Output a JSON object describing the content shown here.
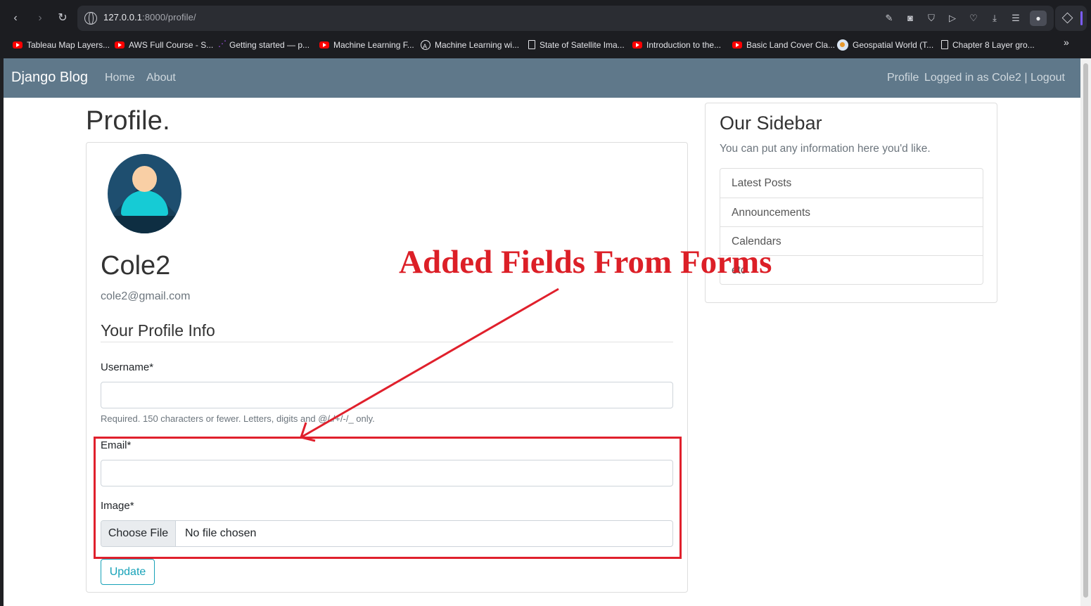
{
  "browser": {
    "url_host": "127.0.0.1",
    "url_rest": ":8000/profile/",
    "bookmarks": [
      {
        "label": "Tableau Map Layers...",
        "icon": "youtube-icon"
      },
      {
        "label": "AWS Full Course - S...",
        "icon": "youtube-icon"
      },
      {
        "label": "Getting started — p...",
        "icon": "app-icon"
      },
      {
        "label": "Machine Learning F...",
        "icon": "youtube-icon"
      },
      {
        "label": "Machine Learning wi...",
        "icon": "site-icon"
      },
      {
        "label": "State of Satellite Ima...",
        "icon": "document-icon"
      },
      {
        "label": "Introduction to the...",
        "icon": "youtube-icon"
      },
      {
        "label": "Basic Land Cover Cla...",
        "icon": "youtube-icon"
      },
      {
        "label": "Geospatial World (T...",
        "icon": "globe-icon"
      },
      {
        "label": "Chapter 8 Layer gro...",
        "icon": "document-icon"
      }
    ],
    "more_label": "»"
  },
  "navbar": {
    "brand": "Django Blog",
    "links": [
      "Home",
      "About"
    ],
    "right": {
      "profile": "Profile",
      "logged_in": "Logged in as Cole2 |",
      "logout": "Logout"
    }
  },
  "main": {
    "title": "Profile.",
    "username": "Cole2",
    "email": "cole2@gmail.com",
    "section_title": "Your Profile Info",
    "form": {
      "username_label": "Username*",
      "username_value": "",
      "username_help": "Required. 150 characters or fewer. Letters, digits and @/./+/-/_ only.",
      "email_label": "Email*",
      "email_value": "",
      "image_label": "Image*",
      "file_button": "Choose File",
      "file_status": "No file chosen",
      "submit": "Update"
    }
  },
  "sidebar": {
    "title": "Our Sidebar",
    "text": "You can put any information here you'd like.",
    "items": [
      "Latest Posts",
      "Announcements",
      "Calendars",
      "etc"
    ]
  },
  "annotation": {
    "text": "Added Fields From Forms",
    "color": "#dc1f27"
  },
  "colors": {
    "navbar": "#5f788a",
    "accent_info": "#17a2b8"
  }
}
